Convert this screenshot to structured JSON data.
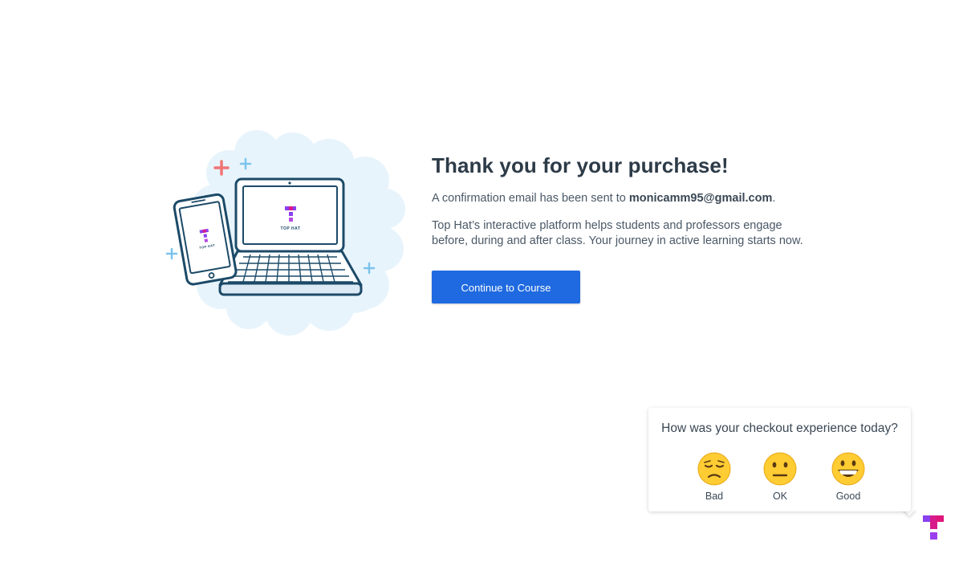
{
  "confirmation": {
    "title": "Thank you for your purchase!",
    "email_prefix": "A confirmation email has been sent to ",
    "email": "monicamm95@gmail.com",
    "email_suffix": ".",
    "description": "Top Hat’s interactive platform helps students and professors engage before, during and after class. Your journey in active learning starts now.",
    "continue_label": "Continue to Course"
  },
  "illustration": {
    "device_brand": "TOP HAT"
  },
  "feedback": {
    "question": "How was your checkout experience today?",
    "options": [
      {
        "label": "Bad",
        "icon": "sad-face-icon"
      },
      {
        "label": "OK",
        "icon": "neutral-face-icon"
      },
      {
        "label": "Good",
        "icon": "happy-face-icon"
      }
    ]
  },
  "colors": {
    "primary_button": "#1f6ae0",
    "heading_text": "#2d3b48",
    "brand_magenta": "#d81b8a",
    "brand_purple": "#8a3ff0"
  }
}
